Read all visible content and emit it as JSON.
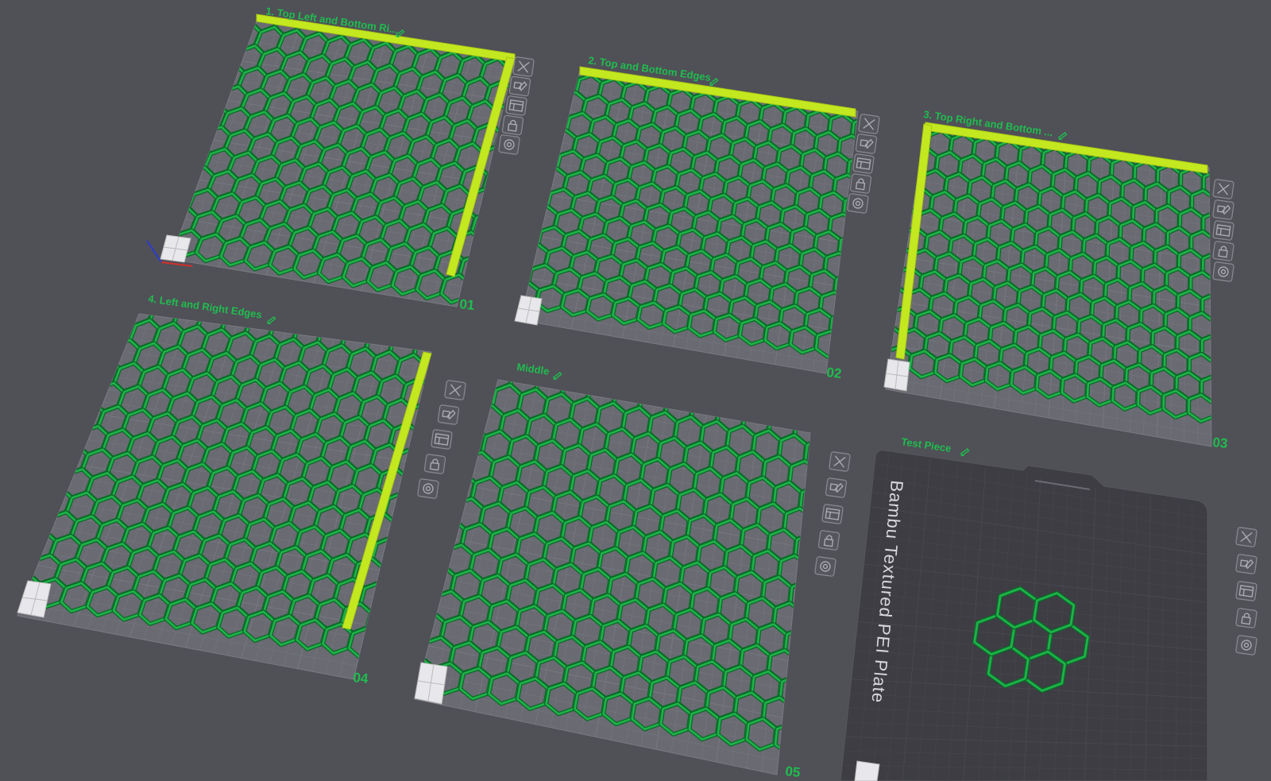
{
  "colors": {
    "background": "#505057",
    "plate_surface": "#6a6a72",
    "plate_grid": "#7c7c85",
    "textured_plate": "#3d3d43",
    "hex_model": "#1fb24a",
    "hex_model_dark": "#0b6a28",
    "edge_bar": "#c4e820",
    "label": "#1fbd4e"
  },
  "plates": [
    {
      "id": "plate-01",
      "number": "01",
      "title": "1. Top Left and Bottom Ri...",
      "edges": [
        "top",
        "right"
      ]
    },
    {
      "id": "plate-02",
      "number": "02",
      "title": "2. Top and Bottom Edges",
      "edges": [
        "top"
      ]
    },
    {
      "id": "plate-03",
      "number": "03",
      "title": "3. Top Right and Bottom ...",
      "edges": [
        "top",
        "left"
      ]
    },
    {
      "id": "plate-04",
      "number": "04",
      "title": "4. Left and Right Edges",
      "edges": [
        "right"
      ]
    },
    {
      "id": "plate-05",
      "number": "05",
      "title": "Middle",
      "edges": []
    },
    {
      "id": "plate-06",
      "number": "",
      "title": "Test Piece",
      "edges": [],
      "bed_label": "Bambu Textured PEI Plate"
    }
  ],
  "plate_tools": [
    {
      "name": "delete-plate",
      "icon": "close-icon"
    },
    {
      "name": "arrange-plate",
      "icon": "arrange-icon"
    },
    {
      "name": "orient-plate",
      "icon": "layout-icon"
    },
    {
      "name": "lock-plate",
      "icon": "lock-icon"
    },
    {
      "name": "plate-settings",
      "icon": "gear-icon"
    }
  ]
}
